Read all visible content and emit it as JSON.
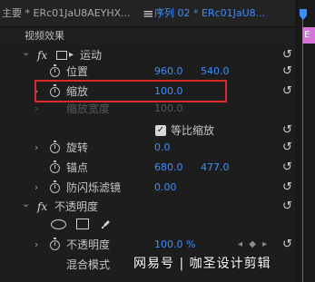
{
  "tabs": {
    "master": "主要 * ERc01JaU8AEYHX...",
    "separator": "≡",
    "sequence": "序列 02 * ERc01JaU8..."
  },
  "timeline": {
    "clip_label": "E"
  },
  "section_title": "视频效果",
  "motion": {
    "fx": "fx",
    "label": "运动",
    "position": {
      "label": "位置",
      "x": "960.0",
      "y": "540.0"
    },
    "scale": {
      "label": "缩放",
      "value": "100.0"
    },
    "scale_width": {
      "label": "缩放宽度",
      "value": "100.0"
    },
    "uniform_scale": {
      "label": "等比缩放",
      "checked": true
    },
    "rotation": {
      "label": "旋转",
      "value": "0.0"
    },
    "anchor": {
      "label": "锚点",
      "x": "680.0",
      "y": "477.0"
    },
    "flicker": {
      "label": "防闪烁滤镜",
      "value": "0.00"
    }
  },
  "opacity": {
    "fx": "fx",
    "label": "不透明度",
    "opacity_row": {
      "label": "不透明度",
      "value": "100.0 %"
    },
    "blend_mode": {
      "label": "混合模式"
    }
  },
  "icons": {
    "reset": "↺",
    "chevron_down": "⌄",
    "chevron_right": "›",
    "keyframe_nav": "◂ ◆ ▸"
  },
  "watermark": "网易号 | 咖圣设计剪辑",
  "colors": {
    "accent": "#3d8dff",
    "highlight": "#d92b2b",
    "clip": "#d774d9"
  }
}
